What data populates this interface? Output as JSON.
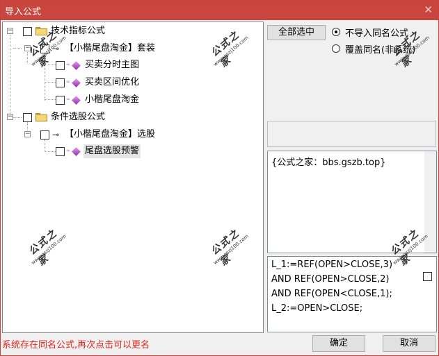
{
  "window": {
    "title": "导入公式",
    "close_glyph": "✕"
  },
  "tree": {
    "groups": [
      {
        "label": "技术指标公式",
        "sub": {
          "label": "【小楷尾盘淘金】套装",
          "items": [
            "买卖分时主图",
            "买卖区间优化",
            "小楷尾盘淘金"
          ]
        }
      },
      {
        "label": "条件选股公式",
        "sub": {
          "label": "【小楷尾盘淘金】选股",
          "items": [
            "尾盘选股预警"
          ]
        }
      }
    ],
    "expander_minus": "−",
    "key_glyph": "⊸"
  },
  "options": {
    "select_all_label": "全部选中",
    "radio_no_import": "不导入同名公式",
    "radio_overwrite": "覆盖同名(非系统)"
  },
  "description": {
    "text": "{公式之家：bbs.gszb.top}"
  },
  "code": {
    "lines": [
      "L_1:=REF(OPEN>CLOSE,3)",
      "AND REF(OPEN>CLOSE,2)",
      "AND REF(OPEN<CLOSE,1);",
      "L_2:=OPEN>CLOSE;"
    ]
  },
  "status": {
    "message": "系统存在同名公式,再次点击可以更名"
  },
  "buttons": {
    "ok": "确定",
    "cancel": "取消"
  },
  "watermark": {
    "big": "公式之家",
    "small": "www.gszj100.com"
  },
  "colors": {
    "titlebar": "#c8463e",
    "status_text": "#e0261e",
    "gem": "#a63cc0",
    "folder": "#f6d776"
  }
}
